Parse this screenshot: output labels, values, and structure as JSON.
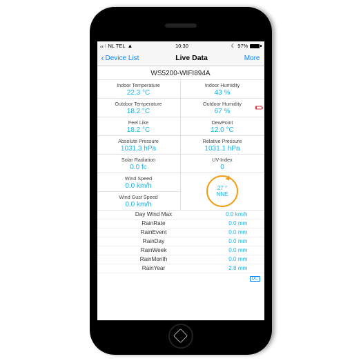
{
  "status": {
    "carrier": "NL TEL",
    "time": "10:30",
    "battery_pct": "97%"
  },
  "nav": {
    "back": "Device List",
    "title": "Live Data",
    "more": "More"
  },
  "device_name": "WS5200-WIFI894A",
  "metrics": [
    {
      "label": "Indoor Temperature",
      "value": "22.3 °C"
    },
    {
      "label": "Indoor Humidity",
      "value": "43 %"
    },
    {
      "label": "Outdoor Temperature",
      "value": "18.2 °C"
    },
    {
      "label": "Outdoor Humidity",
      "value": "67 %",
      "low_battery": true
    },
    {
      "label": "Feel Like",
      "value": "18.2 °C"
    },
    {
      "label": "DewPoint",
      "value": "12.0 °C"
    },
    {
      "label": "Absolute Pressure",
      "value": "1031.3 hPa"
    },
    {
      "label": "Relative Pressure",
      "value": "1031.1 hPa"
    },
    {
      "label": "Solar Radiation",
      "value": "0.0 fc"
    },
    {
      "label": "UV-Index",
      "value": "0"
    }
  ],
  "wind": {
    "speed_label": "Wind Speed",
    "speed_value": "0.0 km/h",
    "gust_label": "Wind Gust Speed",
    "gust_value": "0.0 km/h",
    "direction_deg": "27 °",
    "direction_name": "NNE"
  },
  "rows": [
    {
      "label": "Day Wind Max",
      "value": "0.0 km/h"
    },
    {
      "label": "RainRate",
      "value": "0.0 mm"
    },
    {
      "label": "RainEvent",
      "value": "0.0 mm"
    },
    {
      "label": "RainDay",
      "value": "0.0 mm"
    },
    {
      "label": "RainWeek",
      "value": "0.0 mm"
    },
    {
      "label": "RainMonth",
      "value": "0.0 mm"
    },
    {
      "label": "RainYear",
      "value": "2.8 mm"
    }
  ],
  "footer_badge": "DC"
}
